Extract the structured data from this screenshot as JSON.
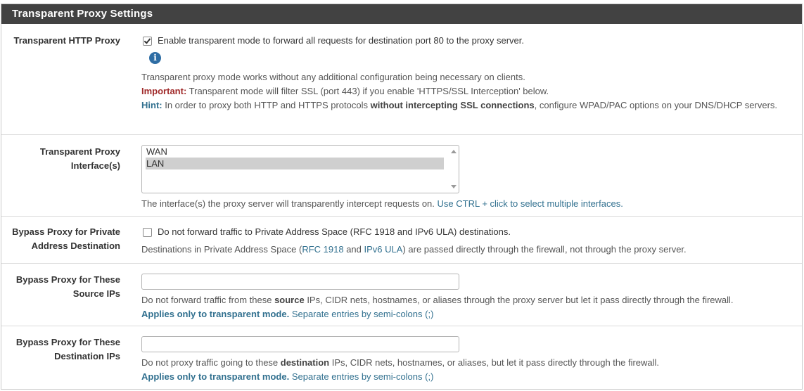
{
  "panel": {
    "title": "Transparent Proxy Settings"
  },
  "transparent_http": {
    "label": "Transparent HTTP Proxy",
    "checkbox_label": "Enable transparent mode to forward all requests for destination port 80 to the proxy server.",
    "checked": true,
    "help_line1": "Transparent proxy mode works without any additional configuration being necessary on clients.",
    "important_label": "Important:",
    "important_text": " Transparent mode will filter SSL (port 443) if you enable 'HTTPS/SSL Interception' below.",
    "hint_label": "Hint:",
    "hint_text_a": " In order to proxy both HTTP and HTTPS protocols ",
    "hint_bold": "without intercepting SSL connections",
    "hint_text_b": ", configure WPAD/PAC options on your DNS/DHCP servers."
  },
  "interfaces": {
    "label_line1": "Transparent Proxy",
    "label_line2": "Interface(s)",
    "options": [
      "WAN",
      "LAN"
    ],
    "selected": "LAN",
    "help_text": "The interface(s) the proxy server will transparently intercept requests on. ",
    "help_link": "Use CTRL + click to select multiple interfaces."
  },
  "bypass_private": {
    "label_line1": "Bypass Proxy for Private",
    "label_line2": "Address Destination",
    "checkbox_label": "Do not forward traffic to Private Address Space (RFC 1918 and IPv6 ULA) destinations.",
    "checked": false,
    "help_a": "Destinations in Private Address Space (",
    "help_link1": "RFC 1918",
    "help_b": " and ",
    "help_link2": "IPv6 ULA",
    "help_c": ") are passed directly through the firewall, not through the proxy server."
  },
  "bypass_source": {
    "label_line1": "Bypass Proxy for These",
    "label_line2": "Source IPs",
    "value": "",
    "help_a": "Do not forward traffic from these ",
    "help_bold": "source",
    "help_b": " IPs, CIDR nets, hostnames, or aliases through the proxy server but let it pass directly through the firewall.",
    "applies_label": "Applies only to transparent mode.",
    "applies_text": " Separate entries by semi-colons (;)"
  },
  "bypass_dest": {
    "label_line1": "Bypass Proxy for These",
    "label_line2": "Destination IPs",
    "value": "",
    "help_a": "Do not proxy traffic going to these ",
    "help_bold": "destination",
    "help_b": " IPs, CIDR nets, hostnames, or aliases, but let it pass directly through the firewall.",
    "applies_label": "Applies only to transparent mode.",
    "applies_text": " Separate entries by semi-colons (;)"
  },
  "colors": {
    "header_bg": "#424242",
    "link": "#31708f",
    "important": "#a02a2a"
  }
}
